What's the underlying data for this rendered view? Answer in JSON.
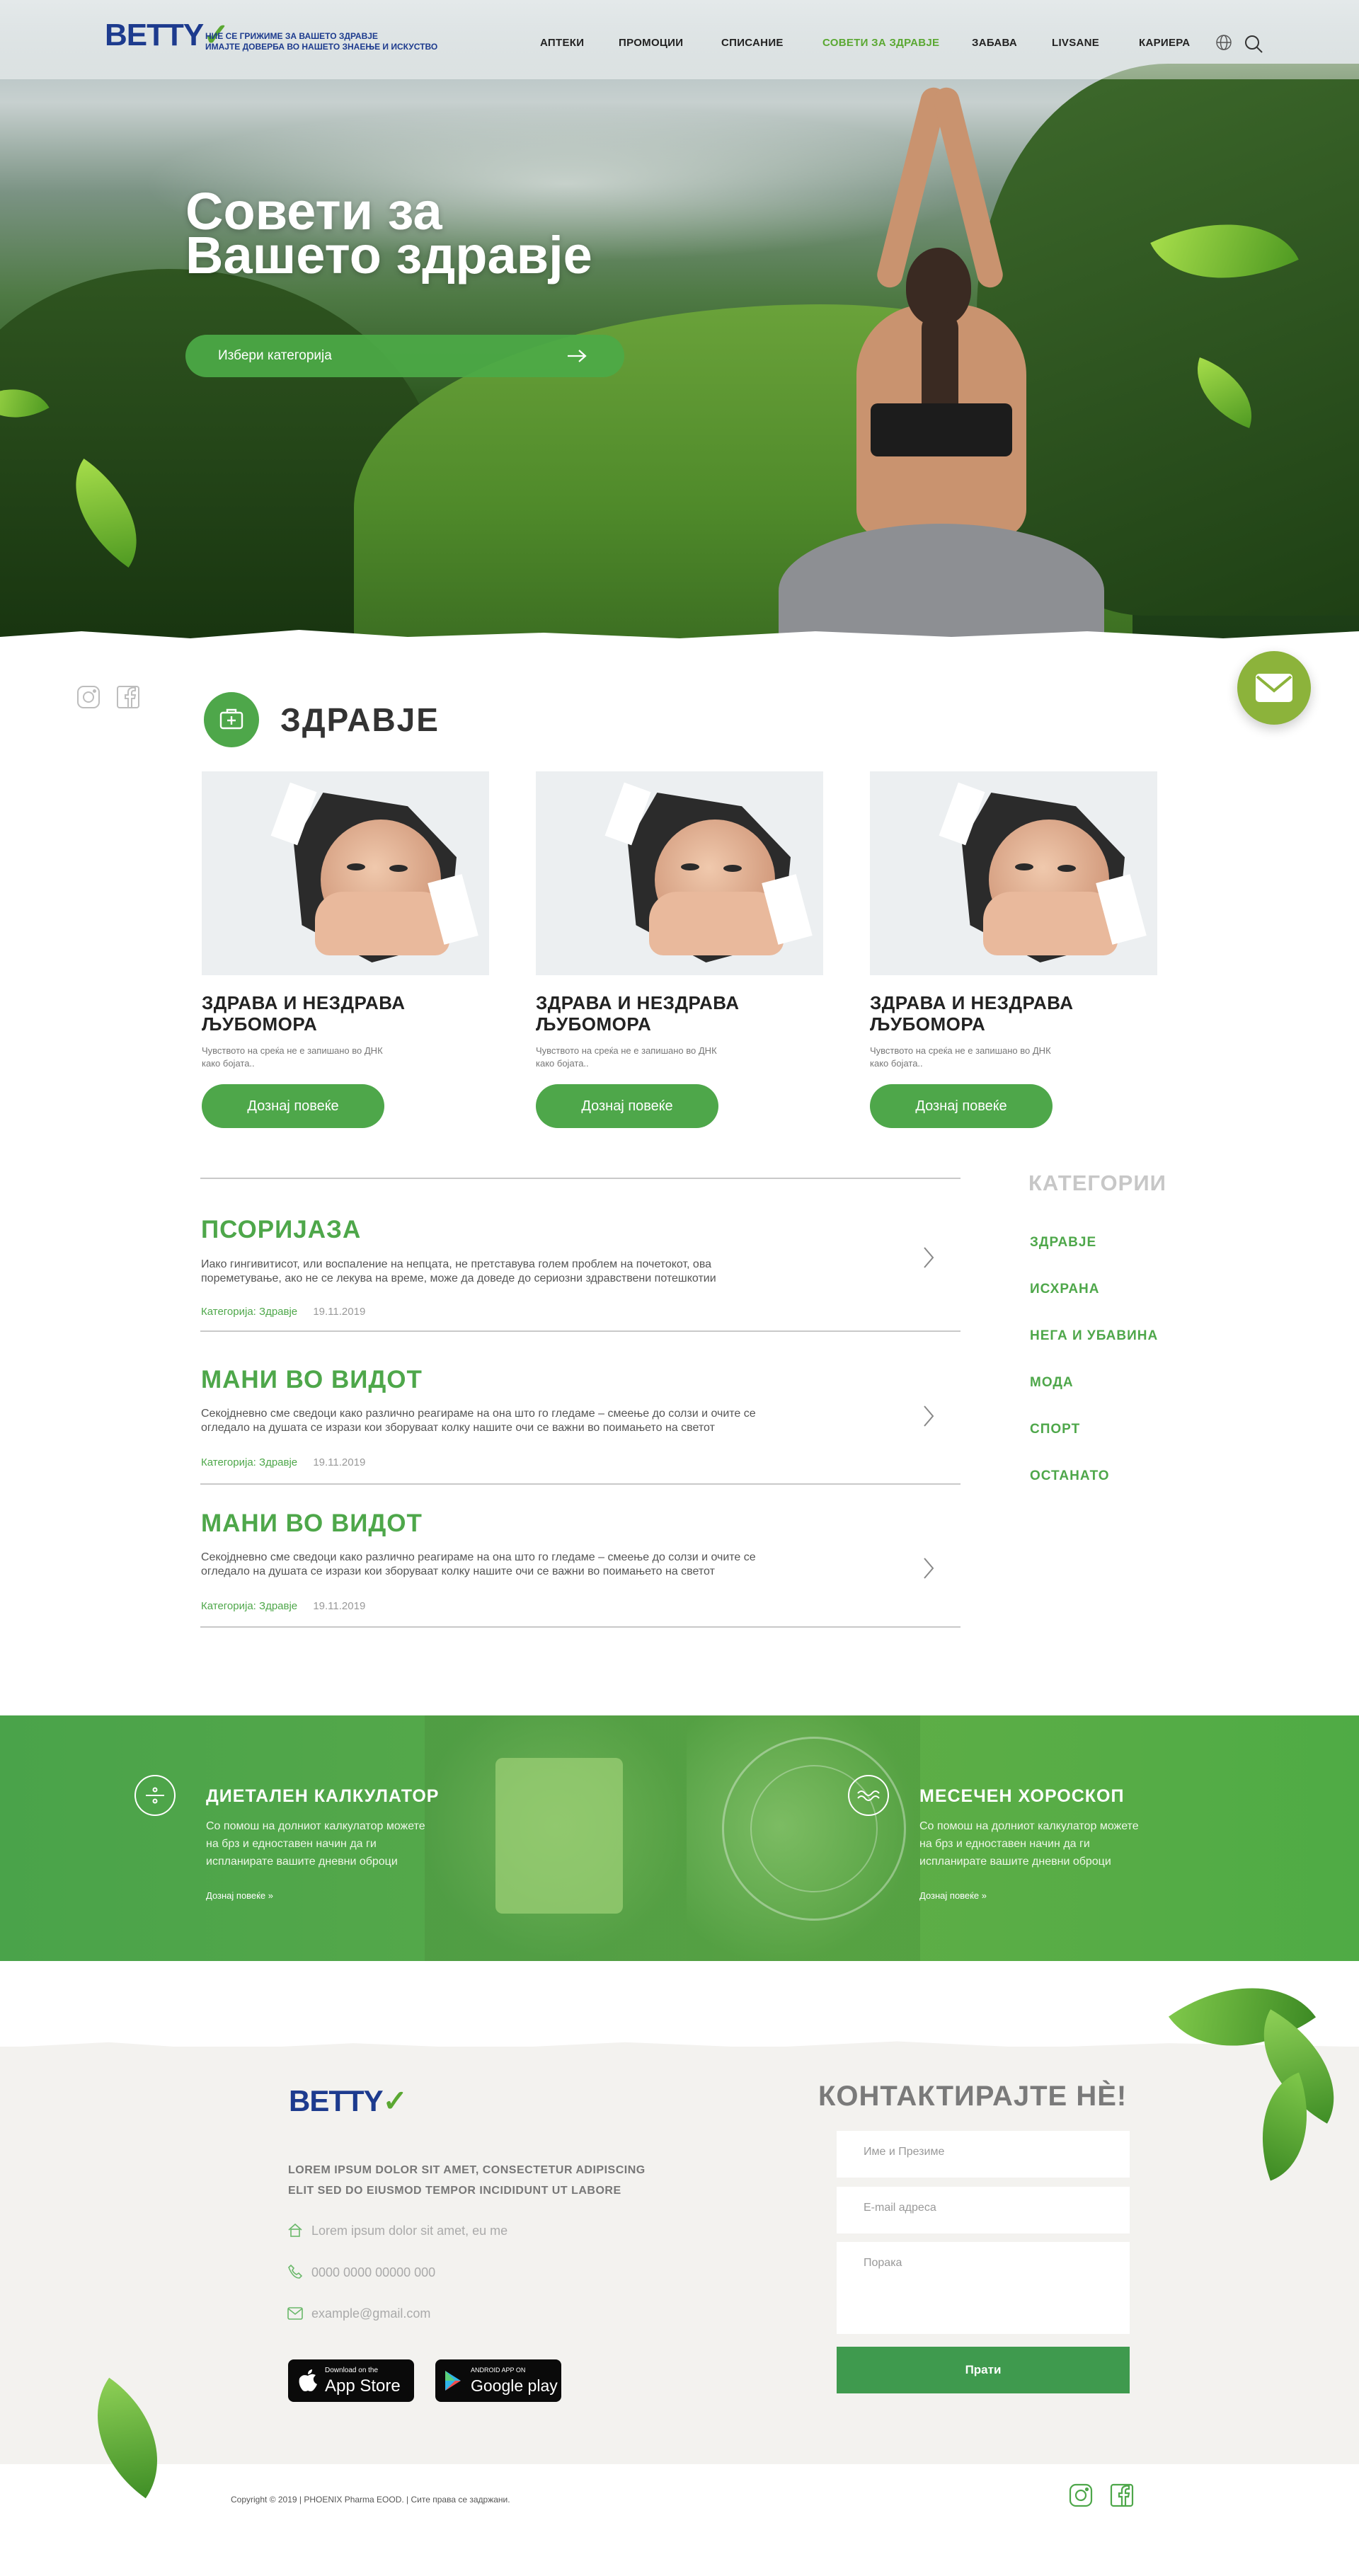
{
  "header": {
    "logo_text": "BETTY",
    "tagline_line1": "НИЕ СЕ ГРИЖИМЕ ЗА ВАШЕТО ЗДРАВЈЕ",
    "tagline_line2": "ИМАЈТЕ ДОВЕРБА ВО НАШЕТО ЗНАЕЊЕ И ИСКУСТВО",
    "nav": [
      {
        "label": "АПТЕКИ"
      },
      {
        "label": "ПРОМОЦИИ"
      },
      {
        "label": "СПИСАНИЕ"
      },
      {
        "label": "СОВЕТИ ЗА ЗДРАВЈЕ",
        "active": true
      },
      {
        "label": "ЗАБАВА"
      },
      {
        "label": "LIVSANE"
      },
      {
        "label": "КАРИЕРА"
      }
    ]
  },
  "hero": {
    "title_line1": "Совети за",
    "title_line2": "Вашето здравје",
    "category_placeholder": "Избери категорија"
  },
  "section": {
    "title": "ЗДРАВЈЕ"
  },
  "cards": [
    {
      "title_line1": "ЗДРАВА И НЕЗДРАВА",
      "title_line2": "ЉУБОМОРА",
      "desc_line1": "Чувството на среќа не е запишано во ДНК",
      "desc_line2": "како бојата..",
      "button": "Дознај повеќе"
    },
    {
      "title_line1": "ЗДРАВА И НЕЗДРАВА",
      "title_line2": "ЉУБОМОРА",
      "desc_line1": "Чувството на среќа не е запишано во ДНК",
      "desc_line2": "како бојата..",
      "button": "Дознај повеќе"
    },
    {
      "title_line1": "ЗДРАВА И НЕЗДРАВА",
      "title_line2": "ЉУБОМОРА",
      "desc_line1": "Чувството на среќа не е запишано во ДНК",
      "desc_line2": "како бојата..",
      "button": "Дознај повеќе"
    }
  ],
  "articles": [
    {
      "title": "ПСОРИЈАЗА",
      "text_line1": "Иако гингивитисот, или воспаление на непцата, не претставува голем проблем на почетокот, ова",
      "text_line2": "пореметување, ако не се лекува на време, може да доведе до сериозни здравствени потешкотии",
      "category": "Категорија: Здравје",
      "date": "19.11.2019"
    },
    {
      "title": "МАНИ ВО ВИДОТ",
      "text_line1": "Секојдневно сме сведоци како различно реагираме на она што го гледаме – смеење до солзи и очите се",
      "text_line2": "огледало на душата се изрази кои зборуваат колку нашите очи се важни во поимањето на светот",
      "category": "Категорија: Здравје",
      "date": "19.11.2019"
    },
    {
      "title": "МАНИ ВО ВИДОТ",
      "text_line1": "Секојдневно сме сведоци како различно реагираме на она што го гледаме – смеење до солзи и очите се",
      "text_line2": "огледало на душата се изрази кои зборуваат колку нашите очи се важни во поимањето на светот",
      "category": "Категорија: Здравје",
      "date": "19.11.2019"
    }
  ],
  "categories": {
    "title": "КАТЕГОРИИ",
    "items": [
      "ЗДРАВЈЕ",
      "ИСХРАНА",
      "НЕГА И УБАВИНА",
      "МОДА",
      "СПОРТ",
      "ОСТАНАТО"
    ]
  },
  "tools": [
    {
      "title": "ДИЕТАЛЕН КАЛКУЛАТОР",
      "text_line1": "Со помош на долниот калкулатор можете",
      "text_line2": " на брз и едноставен начин да ги",
      "text_line3": "испланирате вашите дневни оброци",
      "link": "Дознај повеќе"
    },
    {
      "title": "МЕСЕЧЕН ХОРОСКОП",
      "text_line1": "Со помош на долниот калкулатор можете",
      "text_line2": "на брз и едноставен начин да ги",
      "text_line3": "испланирате вашите дневни оброци",
      "link": "Дознај повеќе"
    }
  ],
  "footer": {
    "logo_text": "BETTY",
    "lorem_line1": "LOREM IPSUM DOLOR SIT AMET, CONSECTETUR ADIPISCING",
    "lorem_line2": "ELIT SED DO EIUSMOD TEMPOR INCIDIDUNT UT LABORE",
    "address": "Lorem ipsum dolor sit amet, eu me",
    "phone": "0000 0000 00000 000",
    "email": "example@gmail.com",
    "appstore_small": "Download on the",
    "appstore_big": "App Store",
    "googleplay_small": "ANDROID APP ON",
    "googleplay_big": "Google play",
    "contact_title": "КОНТАКТИРАЈТЕ НÈ!",
    "name_placeholder": "Име и Презиме",
    "email_placeholder": "E-mail адреса",
    "message_placeholder": "Порака",
    "send": "Прати",
    "copyright": "Copyright © 2019 | PHOENIX Pharma EOOD. | Сите права се задржани."
  },
  "colors": {
    "brand_green": "#4ea74a",
    "brand_blue": "#1d3b8e",
    "mail_button": "#8cb33b"
  }
}
